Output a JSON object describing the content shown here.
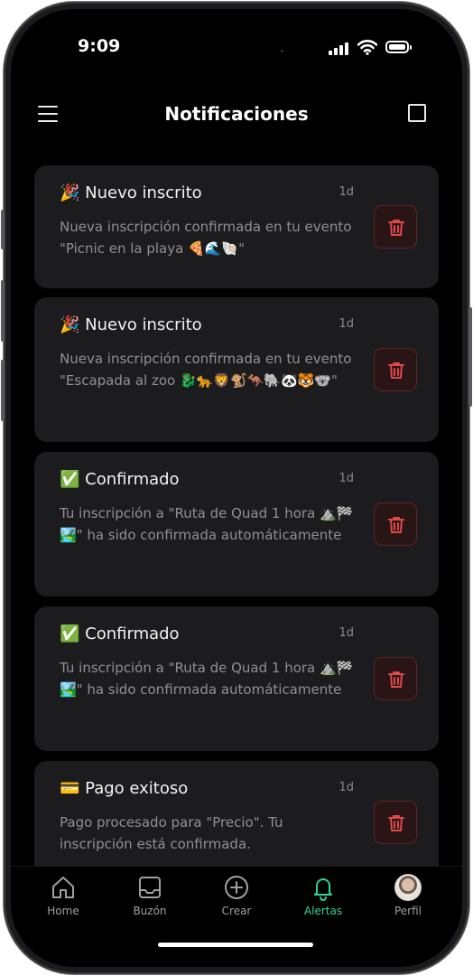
{
  "status_bar": {
    "time": "9:09"
  },
  "header": {
    "title": "Notificaciones"
  },
  "notifications": [
    {
      "emoji": "🎉",
      "title": "Nuevo inscrito",
      "time": "1d",
      "message": "Nueva inscripción confirmada en tu evento \"Picnic en la playa 🍕🌊🐚\""
    },
    {
      "emoji": "🎉",
      "title": "Nuevo inscrito",
      "time": "1d",
      "message": "Nueva inscripción confirmada en tu evento \"Escapada al zoo 🐉🐆🦁🐒🦘🐘🐼🐯🐨\""
    },
    {
      "emoji": "✅",
      "title": "Confirmado",
      "time": "1d",
      "message": "Tu inscripción a \"Ruta de Quad 1 hora ⛰️🏁🏞️\" ha sido confirmada automáticamente"
    },
    {
      "emoji": "✅",
      "title": "Confirmado",
      "time": "1d",
      "message": "Tu inscripción a \"Ruta de Quad 1 hora ⛰️🏁🏞️\" ha sido confirmada automáticamente"
    },
    {
      "emoji": "💳",
      "title": "Pago exitoso",
      "time": "1d",
      "message": "Pago procesado para \"Precio\". Tu inscripción está confirmada."
    }
  ],
  "tabbar": {
    "home": "Home",
    "inbox": "Buzón",
    "create": "Crear",
    "alerts": "Alertas",
    "profile": "Perfil"
  },
  "colors": {
    "accent": "#2fd3a0",
    "delete_border": "#5e2525",
    "delete_icon": "#e0484a",
    "card": "#1c1c1e"
  }
}
